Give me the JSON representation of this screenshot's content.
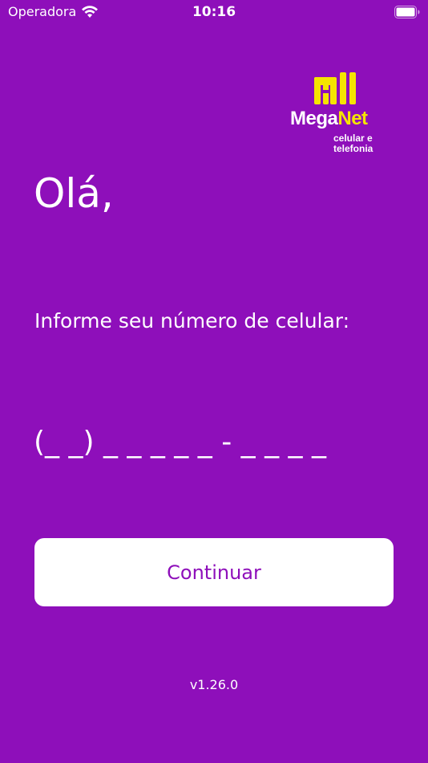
{
  "status_bar": {
    "carrier": "Operadora",
    "time": "10:16",
    "wifi_icon": "wifi-icon",
    "battery_icon": "battery-icon"
  },
  "logo": {
    "name_part1": "Mega",
    "name_part2": "Net",
    "tagline_line1": "celular e",
    "tagline_line2": "telefonia",
    "colors": {
      "accent": "#f5e400",
      "text": "#ffffff"
    }
  },
  "greeting": "Olá,",
  "prompt": "Informe seu número de celular:",
  "phone_input": {
    "placeholder": "(_ _) _ _ _ _ _ - _ _ _ _",
    "value": ""
  },
  "continue_label": "Continuar",
  "version": "v1.26.0",
  "colors": {
    "background": "#8e0fba",
    "button_bg": "#ffffff",
    "button_text": "#8e0fba"
  }
}
